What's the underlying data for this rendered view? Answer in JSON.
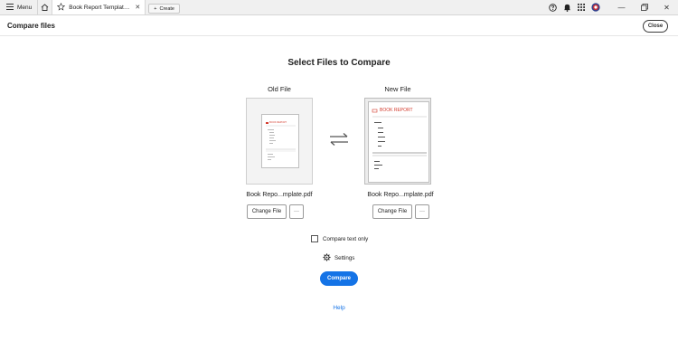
{
  "topbar": {
    "menu_label": "Menu",
    "tab_title": "Book Report Template.p...",
    "create_label": "Create",
    "icons": [
      "help-icon",
      "bell-icon",
      "apps-grid-icon",
      "avatar"
    ]
  },
  "header": {
    "title": "Compare files",
    "close_label": "Close"
  },
  "main": {
    "heading": "Select Files to Compare",
    "old_file": {
      "label": "Old File",
      "filename": "Book Repo...mplate.pdf",
      "change_label": "Change File",
      "more_label": "···",
      "preview_title": "BOOK REPORT"
    },
    "new_file": {
      "label": "New File",
      "filename": "Book Repo...mplate.pdf",
      "change_label": "Change File",
      "more_label": "···",
      "preview_title": "BOOK REPORT"
    },
    "compare_text_only_label": "Compare text only",
    "settings_label": "Settings",
    "compare_label": "Compare",
    "help_label": "Help"
  },
  "colors": {
    "accent": "#1473e6",
    "preview_red": "#d33a2c"
  }
}
